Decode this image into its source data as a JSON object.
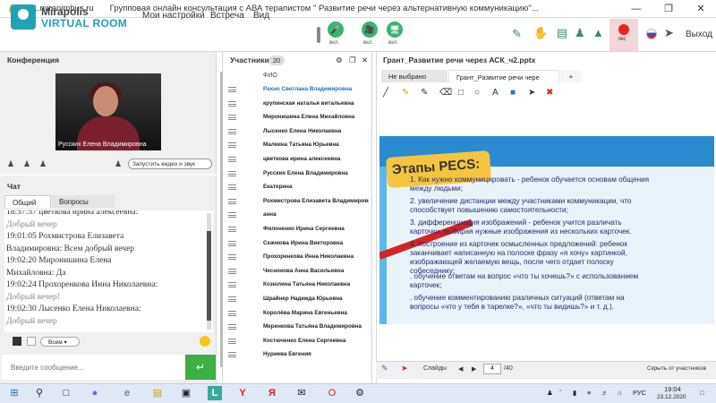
{
  "browser": {
    "url": "mf1.miranimbus.ru",
    "title": "Групповая онлайн консультация с АВА терапистом \" Развитие речи через альтернативную коммуникацию\"..."
  },
  "header": {
    "logo_line1": "Mirapolis",
    "logo_line2": "VIRTUAL ROOM",
    "menu": [
      "Мои настройки",
      "Встреча",
      "Вид"
    ],
    "mic_label": "вкл.",
    "cam_label": "вкл.",
    "screen_label": "вкл.",
    "rec_label": "rec",
    "exit_label": "Выход",
    "accent": "#1fa2b3",
    "green": "#3cb371"
  },
  "conference": {
    "title": "Конференция",
    "video_caption": "Русских Елена Владимировна",
    "start_video_label": "Запустить видео и звук"
  },
  "chat": {
    "title": "Чат",
    "tabs": [
      "Общий",
      "Вопросы"
    ],
    "lines": [
      {
        "text": "18:57:57 цветкова  ирина алексеевна:",
        "dim": false
      },
      {
        "text": "Добрый вечер",
        "dim": true
      },
      {
        "text": "19:01:05 Рохмистрова  Елизавета",
        "dim": false
      },
      {
        "text": "Владимировна: Всем добрый вечер",
        "dim": false
      },
      {
        "text": "19:02:20 Миронишина Елена",
        "dim": false
      },
      {
        "text": "Михайловна: Да",
        "dim": false
      },
      {
        "text": "19:02:24 Прохоренкова Инна Николаевна:",
        "dim": false
      },
      {
        "text": "Добрый вечер!",
        "dim": true
      },
      {
        "text": "19:02:30 Лысенко Елена  Николаевна:",
        "dim": false
      },
      {
        "text": "Добрый вечер",
        "dim": true
      }
    ],
    "recipient": "Всем",
    "input_placeholder": "Введите сообщение..."
  },
  "participants": {
    "title": "Участники",
    "count": "20",
    "column": "ФИО",
    "items": [
      "Рахно Светлана  Владимировна",
      "крупинская  наталья витальевна",
      "Миронишина Елена   Михайловна",
      "Лысенко Елена  Николаевна",
      "Малкина Татьяна  Юрьевна",
      "цветкова  ирина алексеевна",
      "Русских Елена Владимировна",
      "Екатерина",
      "Рохмистрова  Елизавета Владимировна",
      "анна",
      "Филоненко Ирина  Сергеевна",
      "Скачкова  Ирина Викторовна",
      "Прохоренкова Инна Николаевна",
      "Чеснокова  Анна  Васильевна",
      "Козюлина  Татьяна Николаевна",
      "Шрайнер Надежда  Юрьевна",
      "Королёва Марина Евгеньевна",
      "Меренкова  Татьяна  Владимировна",
      "Костюченко  Елена Сергеевна",
      "Нуриева Евгения"
    ]
  },
  "presentation": {
    "title": "Грант_Развитие речи через АСК_ч2.pptx",
    "tabs": [
      "Не выбрано",
      "Грант_Развитие речи чере"
    ],
    "add_tab": "+",
    "slide_title": "Этапы PECS:",
    "slide_points": [
      [
        "1. Как нужно коммуницировать - ребенок обучается основам общения",
        "между людьми;"
      ],
      [
        "2. увеличение дистанции между участниками коммуникации, что",
        "способствует повышению самостоятельности;"
      ],
      [
        "3. дифференциация изображений - ребенок учится различать",
        "карточки, выбирая нужные изображения из нескольких карточек."
      ],
      [
        "4. построение из карточек осмысленных предложений: ребенок",
        "заканчивает написанную на полоске фразу «я хочу» картинкой,",
        "изображающей желаемую вещь, после чего отдает полоску",
        "собеседнику;"
      ],
      [
        ". обучение ответам на вопрос «что ты хочешь?» с использованием",
        "карточек;"
      ],
      [
        ". обучение комментированию различных ситуаций (ответам на",
        "вопросы «что у тебя в тарелке?», «что ты видишь?» и т. д.)."
      ]
    ],
    "slides_label": "Слайды",
    "page": "4",
    "total": "/40",
    "hide_label": "Скрыть от участников"
  },
  "taskbar": {
    "lang": "РУС",
    "time": "19:04",
    "date": "23.12.2020"
  }
}
